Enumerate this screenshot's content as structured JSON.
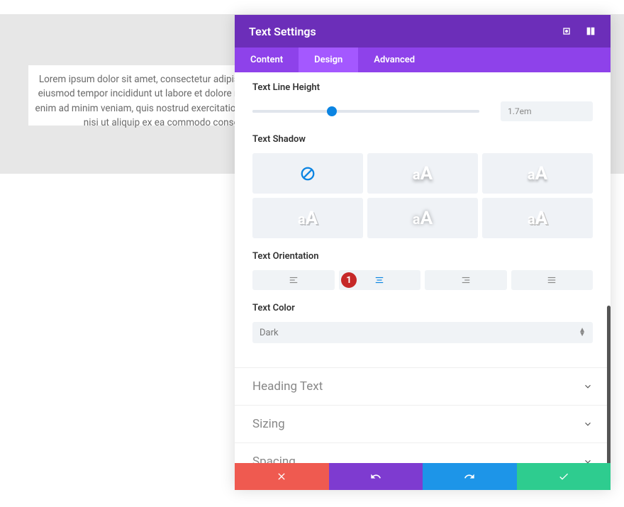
{
  "lorem_text": "Lorem ipsum dolor sit amet, consectetur adipiscing elit, sed do eiusmod tempor incididunt ut labore et dolore magna aliqua. Ut enim ad minim veniam, quis nostrud exercitation ullamco laboris nisi ut aliquip ex ea commodo consequat.",
  "panel": {
    "title": "Text Settings",
    "tabs": {
      "content": "Content",
      "design": "Design",
      "advanced": "Advanced"
    }
  },
  "controls": {
    "line_height_label": "Text Line Height",
    "line_height_value": "1.7em",
    "shadow_label": "Text Shadow",
    "shadow_sample": "aA",
    "orientation_label": "Text Orientation",
    "color_label": "Text Color",
    "color_value": "Dark"
  },
  "badge": "1",
  "accordions": {
    "heading": "Heading Text",
    "sizing": "Sizing",
    "spacing": "Spacing"
  }
}
